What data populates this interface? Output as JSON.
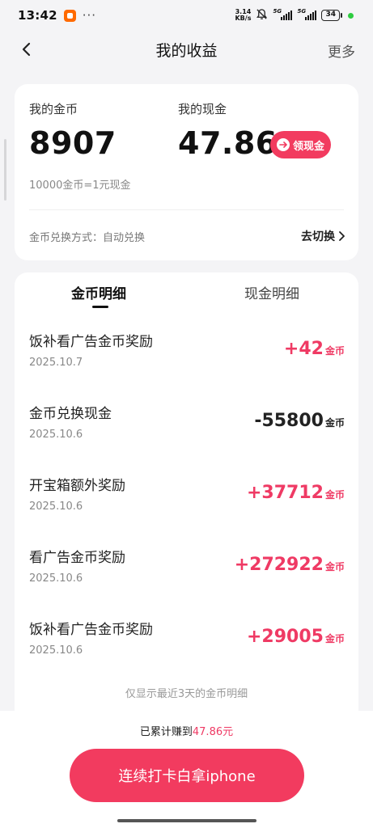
{
  "status_bar": {
    "time": "13:42",
    "more": "···",
    "net_speed_value": "3.14",
    "net_speed_unit": "KB/s",
    "sig1_label": "5G",
    "sig2_label": "5G",
    "battery": "34"
  },
  "header": {
    "title": "我的收益",
    "more": "更多"
  },
  "summary": {
    "coin_label": "我的金币",
    "coin_value": "8907",
    "cash_label": "我的现金",
    "cash_value": "47.86",
    "withdraw_label": "领现金",
    "rate_note": "10000金币=1元现金",
    "exchange_mode": "金币兑换方式：自动兑换",
    "switch_label": "去切换"
  },
  "tabs": {
    "coin": "金币明细",
    "cash": "现金明细"
  },
  "records": [
    {
      "title": "饭补看广告金币奖励",
      "date": "2025.10.7",
      "amount": "+42",
      "unit": "金币"
    },
    {
      "title": "金币兑换现金",
      "date": "2025.10.6",
      "amount": "-55800",
      "unit": "金币"
    },
    {
      "title": "开宝箱额外奖励",
      "date": "2025.10.6",
      "amount": "+37712",
      "unit": "金币"
    },
    {
      "title": "看广告金币奖励",
      "date": "2025.10.6",
      "amount": "+272922",
      "unit": "金币"
    },
    {
      "title": "饭补看广告金币奖励",
      "date": "2025.10.6",
      "amount": "+29005",
      "unit": "金币"
    }
  ],
  "footnote": "仅显示最近3天的金币明细",
  "bottom": {
    "earned_prefix": "已累计赚到",
    "earned_value": "47.86元",
    "cta": "连续打卡白拿iphone"
  },
  "colors": {
    "accent": "#f23b5f",
    "positive": "#ef3a64",
    "background": "#f4f4f6"
  }
}
